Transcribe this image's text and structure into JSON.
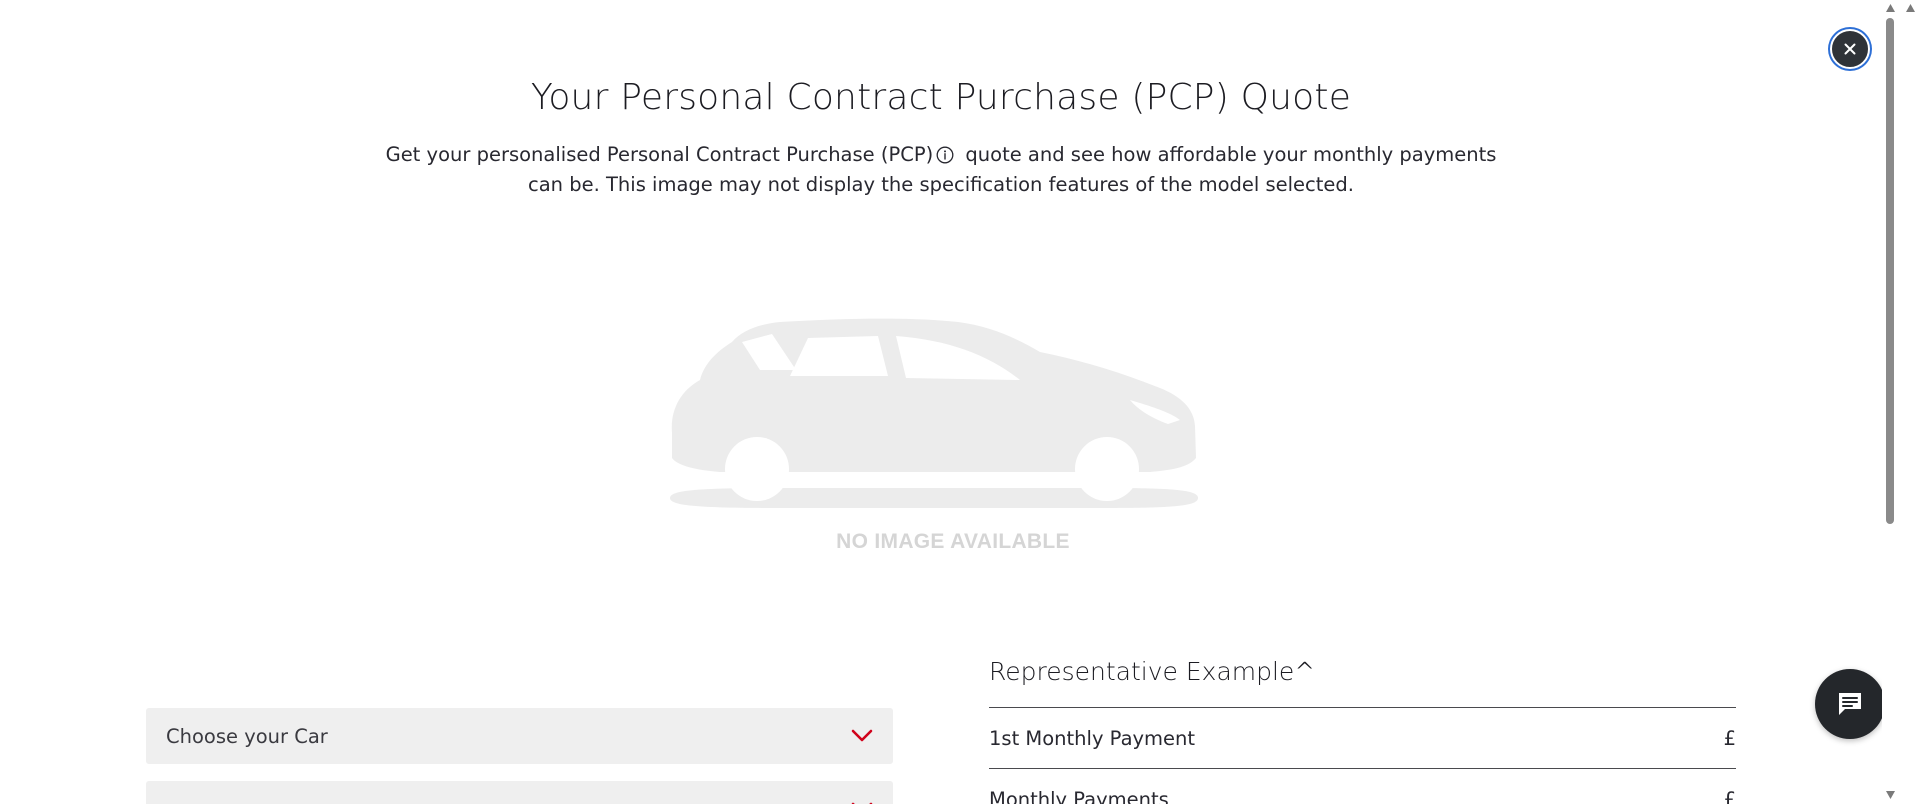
{
  "modal": {
    "title": "Your Personal Contract Purchase (PCP) Quote",
    "subtitle_before_icon": "Get your personalised Personal Contract Purchase (PCP)",
    "subtitle_after_icon": " quote and see how affordable your monthly payments can be. This image may not display the specification features of the model selected.",
    "close_icon": "close-icon",
    "info_icon": "info-icon",
    "placeholder_text": "NO IMAGE AVAILABLE"
  },
  "form": {
    "choose_car_label": "Choose your Car",
    "second_select_label": ""
  },
  "representative_example": {
    "title": "Representative Example^",
    "rows": [
      {
        "label": "1st Monthly Payment",
        "value": "£"
      },
      {
        "label": "Monthly Payments",
        "value": "£"
      }
    ]
  },
  "chat": {
    "icon": "chat-icon"
  },
  "colors": {
    "accent_red": "#d0021b",
    "dark_button": "#2f3338",
    "focus_ring": "#2d6fd6",
    "placeholder_grey": "#ececec"
  }
}
